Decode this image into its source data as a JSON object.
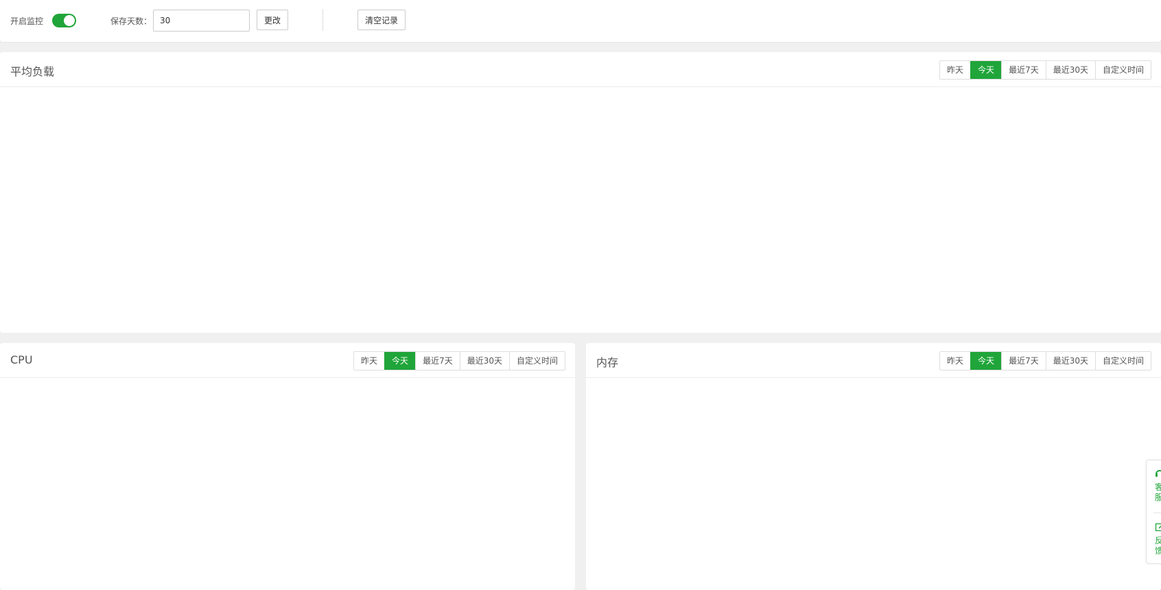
{
  "toolbar": {
    "monitor_label": "开启监控",
    "monitor_enabled": true,
    "save_days_label": "保存天数：",
    "save_days_value": "30",
    "change_button": "更改",
    "clear_button": "清空记录"
  },
  "range_options": [
    "昨天",
    "今天",
    "最近7天",
    "最近30天",
    "自定义时间"
  ],
  "active_range": "今天",
  "panels": {
    "load": {
      "title": "平均负载"
    },
    "cpu": {
      "title": "CPU"
    },
    "memory": {
      "title": "内存"
    }
  },
  "side_float": {
    "service_label": "客服",
    "feedback_label": "反馈"
  },
  "colors": {
    "accent": "#20a53a"
  }
}
